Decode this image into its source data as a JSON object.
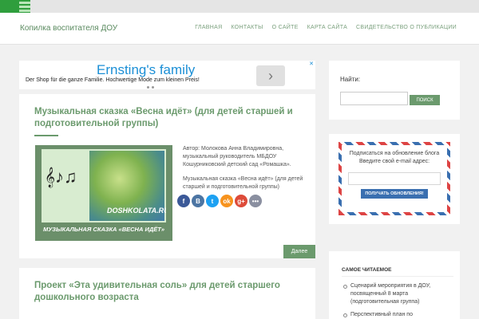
{
  "header": {
    "site_title": "Копилка воспитателя ДОУ",
    "nav": [
      "ГЛАВНАЯ",
      "КОНТАКТЫ",
      "О САЙТЕ",
      "КАРТА САЙТА",
      "СВИДЕТЕЛЬСТВО О ПУБЛИКАЦИИ"
    ]
  },
  "ad": {
    "brand": "Ernsting's family",
    "tagline": "Der Shop für die ganze Familie. Hochwertige Mode zum kleinen Preis!",
    "arrow": "›",
    "close": "✕"
  },
  "posts": [
    {
      "title": "Музыкальная сказка «Весна идёт» (для детей старшей и подготовительной группы)",
      "image": {
        "brand": "DOSHKOLATA.RU",
        "caption": "МУЗЫКАЛЬНАЯ СКАЗКА «ВЕСНА ИДЁТ»"
      },
      "author": "Автор: Молокова Анна Владимировна, музыкальный руководитель МБДОУ Кошурниковский детский сад «Ромашка».",
      "excerpt": "Музыкальная сказка «Весна идёт» (для детей старшей и подготовительной группы)",
      "more_label": "Далее"
    },
    {
      "title": "Проект «Эта удивительная соль» для детей старшего дошкольного возраста"
    }
  ],
  "socials": [
    {
      "icon": "facebook-icon",
      "glyph": "f",
      "color": "#3b5998"
    },
    {
      "icon": "vk-icon",
      "glyph": "B",
      "color": "#4c75a3"
    },
    {
      "icon": "twitter-icon",
      "glyph": "t",
      "color": "#1da1f2"
    },
    {
      "icon": "odnoklassniki-icon",
      "glyph": "ok",
      "color": "#f7931e"
    },
    {
      "icon": "google-plus-icon",
      "glyph": "g+",
      "color": "#dd4b39"
    },
    {
      "icon": "more-icon",
      "glyph": "•••",
      "color": "#8a8fa0"
    }
  ],
  "sidebar": {
    "search": {
      "label": "Найти:",
      "button": "ПОИСК"
    },
    "subscribe": {
      "text": "Подписаться на обновление блога Введите свой e-mail адрес:",
      "button": "ПОЛУЧАТЬ ОБНОВЛЕНИЯ!"
    },
    "popular": {
      "title": "Самое читаемое",
      "items": [
        "Сценарий мероприятия в ДОУ, посвященный 8 марта (подготовительная группа)",
        "Перспективный план по"
      ]
    }
  }
}
